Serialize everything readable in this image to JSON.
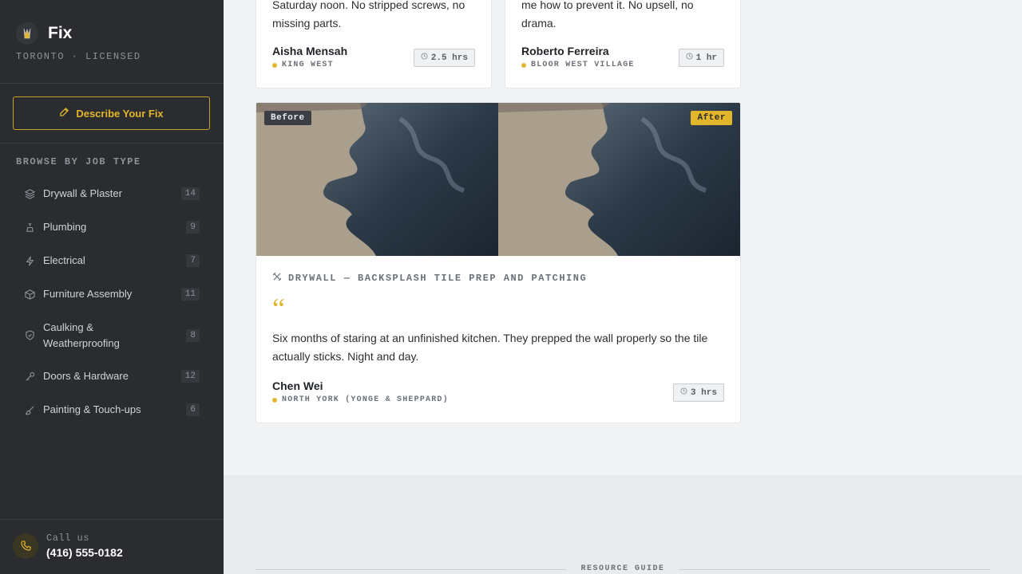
{
  "brand": {
    "name": "Fix",
    "subtitle": "TORONTO · LICENSED"
  },
  "cta": {
    "label": "Describe Your Fix"
  },
  "sidebar": {
    "section_title": "BROWSE BY JOB TYPE",
    "items": [
      {
        "label": "Drywall & Plaster",
        "count": "14",
        "icon": "layers-icon"
      },
      {
        "label": "Plumbing",
        "count": "9",
        "icon": "faucet-icon"
      },
      {
        "label": "Electrical",
        "count": "7",
        "icon": "bolt-icon"
      },
      {
        "label": "Furniture Assembly",
        "count": "11",
        "icon": "box-icon"
      },
      {
        "label": "Caulking & Weatherproofing",
        "count": "8",
        "icon": "shield-icon"
      },
      {
        "label": "Doors & Hardware",
        "count": "12",
        "icon": "key-icon"
      },
      {
        "label": "Painting & Touch-ups",
        "count": "6",
        "icon": "brush-icon"
      }
    ]
  },
  "call": {
    "label": "Call us",
    "number": "(416) 555-0182"
  },
  "reviews": [
    {
      "text": "Saturday noon. No stripped screws, no missing parts.",
      "name": "Aisha Mensah",
      "location": "KING WEST",
      "duration": "2.5 hrs"
    },
    {
      "text": "me how to prevent it. No upsell, no drama.",
      "name": "Roberto Ferreira",
      "location": "BLOOR WEST VILLAGE",
      "duration": "1 hr"
    },
    {
      "before_label": "Before",
      "after_label": "After",
      "job_type": "DRYWALL — BACKSPLASH TILE PREP AND PATCHING",
      "quote_mark": "“",
      "text": "Six months of staring at an unfinished kitchen. They prepped the wall properly so the tile actually sticks. Night and day.",
      "name": "Chen Wei",
      "location": "NORTH YORK (YONGE & SHEPPARD)",
      "duration": "3 hrs"
    }
  ],
  "resource_guide": {
    "label": "RESOURCE GUIDE"
  },
  "colors": {
    "accent": "#e2b52a",
    "sidebar_bg": "#2a2c30",
    "page_bg": "#f2f3f5"
  }
}
